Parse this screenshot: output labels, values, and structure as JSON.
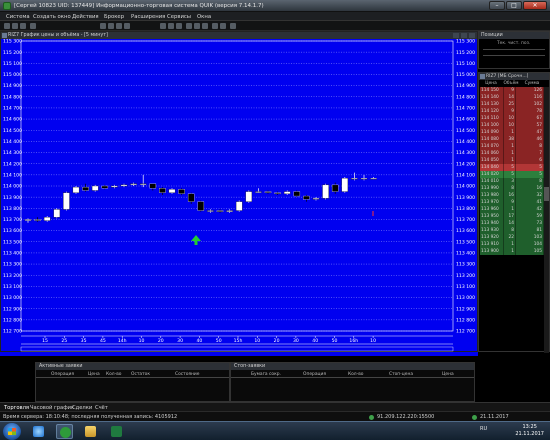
{
  "window": {
    "title": "[Сергей 10823 UID: 137449] Информационно-торговая система QUIK (версия 7.14.1.7)",
    "buttons": [
      "–",
      "□",
      "✕"
    ]
  },
  "menu": [
    "Система",
    "Создать окно",
    "Действия",
    "Брокер",
    "Расширения",
    "Сервисы",
    "Окна"
  ],
  "chart": {
    "header": "RIZ7 График цены и объёма - [5 минут]",
    "price_labels": [
      "115 300",
      "115 200",
      "115 100",
      "115 000",
      "114 900",
      "114 800",
      "114 700",
      "114 600",
      "114 500",
      "114 400",
      "114 300",
      "114 200",
      "114 100",
      "114 000",
      "113 900",
      "113 800",
      "113 700",
      "113 600",
      "113 500",
      "113 400",
      "113 300",
      "113 200",
      "113 100",
      "113 000",
      "112 900",
      "112 800",
      "112 700"
    ],
    "time_labels": [
      "15",
      "25",
      "35",
      "45",
      "14h",
      "10",
      "20",
      "30",
      "40",
      "50",
      "15h",
      "10",
      "20",
      "30",
      "40",
      "50",
      "16h",
      "10"
    ]
  },
  "chart_data": {
    "type": "candlestick",
    "ylim": [
      112700,
      115300
    ],
    "x": [
      "13:10",
      "13:15",
      "13:20",
      "13:25",
      "13:30",
      "13:35",
      "13:40",
      "13:45",
      "13:50",
      "13:55",
      "14:00",
      "14:05",
      "14:10",
      "14:15",
      "14:20",
      "14:25",
      "14:30",
      "14:35",
      "14:40",
      "14:45",
      "14:50",
      "14:55",
      "15:00",
      "15:05",
      "15:10",
      "15:15",
      "15:20",
      "15:25",
      "15:30",
      "15:35",
      "15:40",
      "15:45",
      "15:50",
      "15:55",
      "16:00",
      "16:05",
      "16:10"
    ],
    "ohlc": [
      [
        113690,
        113710,
        113670,
        113700
      ],
      [
        113700,
        113720,
        113680,
        113690
      ],
      [
        113690,
        113730,
        113680,
        113720
      ],
      [
        113720,
        113800,
        113710,
        113790
      ],
      [
        113790,
        113950,
        113780,
        113940
      ],
      [
        113940,
        114000,
        113930,
        113990
      ],
      [
        113990,
        114020,
        113950,
        113960
      ],
      [
        113960,
        114010,
        113950,
        114000
      ],
      [
        114000,
        114010,
        113970,
        113980
      ],
      [
        113990,
        114010,
        113980,
        114000
      ],
      [
        114000,
        114020,
        113990,
        114010
      ],
      [
        114010,
        114030,
        114000,
        114020
      ],
      [
        114020,
        114100,
        113990,
        114020
      ],
      [
        114020,
        114020,
        113960,
        113980
      ],
      [
        113980,
        113990,
        113920,
        113940
      ],
      [
        113940,
        113980,
        113930,
        113970
      ],
      [
        113970,
        113980,
        113920,
        113930
      ],
      [
        113930,
        113940,
        113840,
        113860
      ],
      [
        113860,
        113870,
        113770,
        113780
      ],
      [
        113780,
        113790,
        113760,
        113780
      ],
      [
        113780,
        113790,
        113760,
        113770
      ],
      [
        113770,
        113790,
        113760,
        113780
      ],
      [
        113780,
        113870,
        113770,
        113860
      ],
      [
        113860,
        113960,
        113850,
        113950
      ],
      [
        113950,
        113980,
        113940,
        113950
      ],
      [
        113950,
        113960,
        113930,
        113940
      ],
      [
        113940,
        113950,
        113920,
        113930
      ],
      [
        113930,
        113960,
        113920,
        113950
      ],
      [
        113950,
        113960,
        113900,
        113910
      ],
      [
        113910,
        113920,
        113860,
        113880
      ],
      [
        113880,
        113900,
        113870,
        113890
      ],
      [
        113890,
        114020,
        113880,
        114010
      ],
      [
        114010,
        114030,
        113930,
        113950
      ],
      [
        113950,
        114080,
        113940,
        114070
      ],
      [
        114070,
        114120,
        114050,
        114070
      ],
      [
        114070,
        114100,
        114050,
        114070
      ],
      [
        114070,
        114080,
        114060,
        114070
      ]
    ],
    "grid": true
  },
  "positions": {
    "header": "Позиции",
    "subheader": "Тек. чист. поз."
  },
  "order_book": {
    "header": "RIZ7 [МБ Срочн...]",
    "columns": [
      "Цена",
      "Объём",
      "Сумма"
    ],
    "rows": [
      {
        "price": "114 150",
        "vol": "9",
        "sum": "126",
        "side": "sell"
      },
      {
        "price": "114 140",
        "vol": "14",
        "sum": "116",
        "side": "sell"
      },
      {
        "price": "114 130",
        "vol": "25",
        "sum": "102",
        "side": "sell"
      },
      {
        "price": "114 120",
        "vol": "9",
        "sum": "78",
        "side": "sell"
      },
      {
        "price": "114 110",
        "vol": "10",
        "sum": "67",
        "side": "sell"
      },
      {
        "price": "114 100",
        "vol": "10",
        "sum": "57",
        "side": "sell"
      },
      {
        "price": "114 090",
        "vol": "1",
        "sum": "47",
        "side": "sell"
      },
      {
        "price": "114 080",
        "vol": "38",
        "sum": "46",
        "side": "sell"
      },
      {
        "price": "114 070",
        "vol": "1",
        "sum": "8",
        "side": "sell"
      },
      {
        "price": "114 060",
        "vol": "1",
        "sum": "7",
        "side": "sell"
      },
      {
        "price": "114 050",
        "vol": "1",
        "sum": "6",
        "side": "sell"
      },
      {
        "price": "114 040",
        "vol": "5",
        "sum": "5",
        "side": "best-sell"
      },
      {
        "price": "114 020",
        "vol": "5",
        "sum": "5",
        "side": "best-buy"
      },
      {
        "price": "114 010",
        "vol": "3",
        "sum": "8",
        "side": "buy"
      },
      {
        "price": "113 990",
        "vol": "8",
        "sum": "16",
        "side": "buy"
      },
      {
        "price": "113 980",
        "vol": "16",
        "sum": "32",
        "side": "buy"
      },
      {
        "price": "113 970",
        "vol": "9",
        "sum": "41",
        "side": "buy"
      },
      {
        "price": "113 960",
        "vol": "1",
        "sum": "42",
        "side": "buy"
      },
      {
        "price": "113 950",
        "vol": "17",
        "sum": "59",
        "side": "buy"
      },
      {
        "price": "113 940",
        "vol": "14",
        "sum": "73",
        "side": "buy"
      },
      {
        "price": "113 930",
        "vol": "8",
        "sum": "81",
        "side": "buy"
      },
      {
        "price": "113 920",
        "vol": "22",
        "sum": "103",
        "side": "buy"
      },
      {
        "price": "113 910",
        "vol": "1",
        "sum": "104",
        "side": "buy"
      },
      {
        "price": "113 900",
        "vol": "1",
        "sum": "105",
        "side": "buy"
      }
    ]
  },
  "active_orders": {
    "header": "Активные заявки",
    "columns": [
      "Операция",
      "Цена",
      "Кол-во",
      "Остаток",
      "Состояние"
    ]
  },
  "stop_orders": {
    "header": "Стоп-заявки",
    "columns": [
      "Бумага сокр.",
      "Операция",
      "Кол-во",
      "Стоп-цена",
      "Цена"
    ]
  },
  "tabs": [
    "Торговля",
    "Часовой график",
    "Сделки",
    "Счёт"
  ],
  "status": {
    "text": "Время сервера: 18:10:48; последняя полученная запись: 4105912",
    "server": "91.209.122.220:15500",
    "date": "21.11.2017"
  },
  "taskbar": {
    "clock_time": "13:25",
    "clock_date": "21.11.2017",
    "lang": "RU"
  },
  "colors": {
    "chart_bg": "#0000f0",
    "sell": "#8a2424",
    "buy": "#1f5f2c"
  }
}
